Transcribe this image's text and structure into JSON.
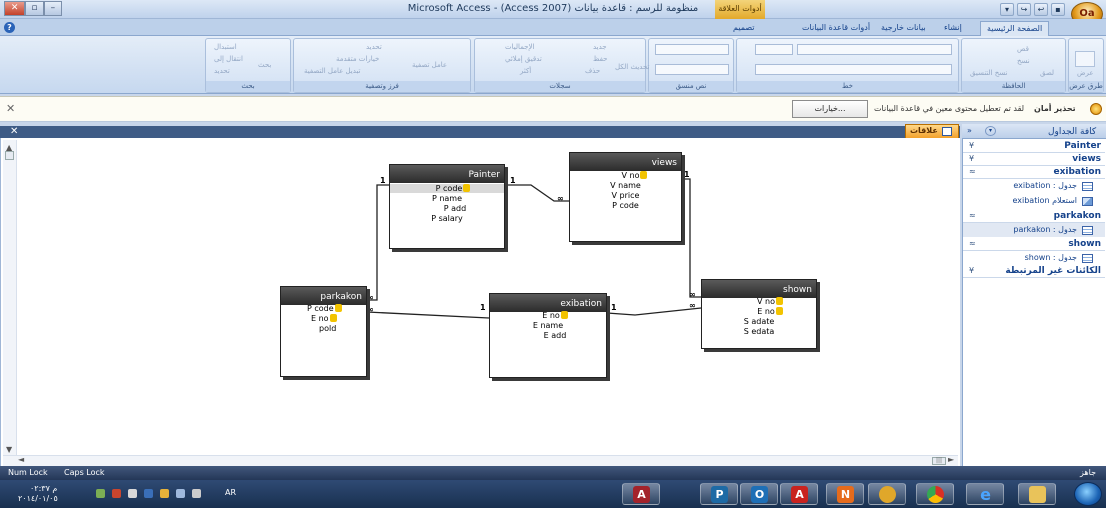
{
  "window": {
    "title": "Microsoft Access - (Access 2007) منظومة للرسم : قاعدة بيانات",
    "context_tab": "أدوات العلاقة",
    "office_button": "Oa"
  },
  "ribbon_tabs": [
    {
      "label": "الصفحة الرئيسية",
      "active": true
    },
    {
      "label": "إنشاء",
      "active": false
    },
    {
      "label": "بيانات خارجية",
      "active": false
    },
    {
      "label": "أدوات قاعدة البيانات",
      "active": false
    },
    {
      "label": "تصميم",
      "active": false
    }
  ],
  "ribbon_groups": [
    {
      "label": "طرق عرض",
      "buttons": [
        "عرض"
      ]
    },
    {
      "label": "الحافظة",
      "buttons": [
        "قص",
        "نسخ",
        "لصق",
        "نسخ التنسيق"
      ]
    },
    {
      "label": "خط",
      "buttons": []
    },
    {
      "label": "نص منسق",
      "buttons": []
    },
    {
      "label": "سجلات",
      "buttons": [
        "جديد",
        "حفظ",
        "حذف",
        "الإجماليات",
        "تدقيق إملائي",
        "أكثر",
        "تحديث الكل"
      ]
    },
    {
      "label": "فرز وتصفية",
      "buttons": [
        "تحديد",
        "خيارات متقدمة",
        "تبديل عامل التصفية",
        "عامل تصفية"
      ]
    },
    {
      "label": "بحث",
      "buttons": [
        "بحث",
        "استبدال",
        "انتقال إلى",
        "تحديد"
      ]
    }
  ],
  "warning": {
    "title": "تحذير أمان",
    "message": "لقد تم تعطيل محتوى معين في قاعدة البيانات",
    "options_label": "خيارات..."
  },
  "document_tab": {
    "label": "علاقات"
  },
  "tables": [
    {
      "name": "Painter",
      "fields": [
        {
          "name": "P code",
          "key": true,
          "selected": true
        },
        {
          "name": "P name"
        },
        {
          "name": "P add"
        },
        {
          "name": "P salary"
        }
      ]
    },
    {
      "name": "views",
      "fields": [
        {
          "name": "V no",
          "key": true
        },
        {
          "name": "V name"
        },
        {
          "name": "V price"
        },
        {
          "name": "P code"
        }
      ]
    },
    {
      "name": "parkakon",
      "fields": [
        {
          "name": "P code",
          "key": true
        },
        {
          "name": "E no",
          "key": true
        },
        {
          "name": "pold"
        }
      ]
    },
    {
      "name": "exibation",
      "fields": [
        {
          "name": "E no",
          "key": true
        },
        {
          "name": "E name"
        },
        {
          "name": "E add"
        }
      ]
    },
    {
      "name": "shown",
      "fields": [
        {
          "name": "V no",
          "key": true
        },
        {
          "name": "E no",
          "key": true
        },
        {
          "name": "S adate"
        },
        {
          "name": "S edata"
        }
      ]
    }
  ],
  "relationships": [
    {
      "from": "Painter.P code",
      "to": "views.P code",
      "one": "1",
      "many": "∞"
    },
    {
      "from": "Painter.P code",
      "to": "parkakon.P code",
      "one": "1",
      "many": "∞"
    },
    {
      "from": "exibation.E no",
      "to": "parkakon.E no",
      "one": "1",
      "many": "∞"
    },
    {
      "from": "exibation.E no",
      "to": "shown.E no",
      "one": "1",
      "many": "∞"
    },
    {
      "from": "views.V no",
      "to": "shown.V no",
      "one": "1",
      "many": "∞"
    }
  ],
  "nav_pane": {
    "title": "كافة الجداول",
    "groups": [
      {
        "label": "Painter",
        "expanded": false
      },
      {
        "label": "views",
        "expanded": false
      },
      {
        "label": "exibation",
        "expanded": true,
        "items": [
          {
            "label": "exibation : جدول",
            "icon": "table-icon"
          },
          {
            "label": "exibation استعلام",
            "icon": "query-icon"
          }
        ]
      },
      {
        "label": "parkakon",
        "expanded": true,
        "items": [
          {
            "label": "parkakon : جدول",
            "icon": "table-icon",
            "highlighted": true
          }
        ]
      },
      {
        "label": "shown",
        "expanded": true,
        "items": [
          {
            "label": "shown : جدول",
            "icon": "table-icon"
          }
        ]
      },
      {
        "label": "الكائنات غير المرتبطة",
        "expanded": false
      }
    ]
  },
  "status": {
    "num_lock": "Num Lock",
    "caps_lock": "Caps Lock",
    "ready": "جاهز"
  },
  "taskbar": {
    "time": "م ٠٢:٣٧",
    "date": "٢٠١٤/٠١/٠٥",
    "lang": "AR",
    "apps": [
      "access",
      "publisher",
      "outlook",
      "acrobat",
      "onenote",
      "winamp",
      "chrome",
      "ie",
      "explorer"
    ]
  },
  "colors": {
    "accent": "#f3a12b",
    "table_header": "#2b2b2b",
    "ribbon": "#c6d8ef",
    "taskbar": "#18304f"
  }
}
